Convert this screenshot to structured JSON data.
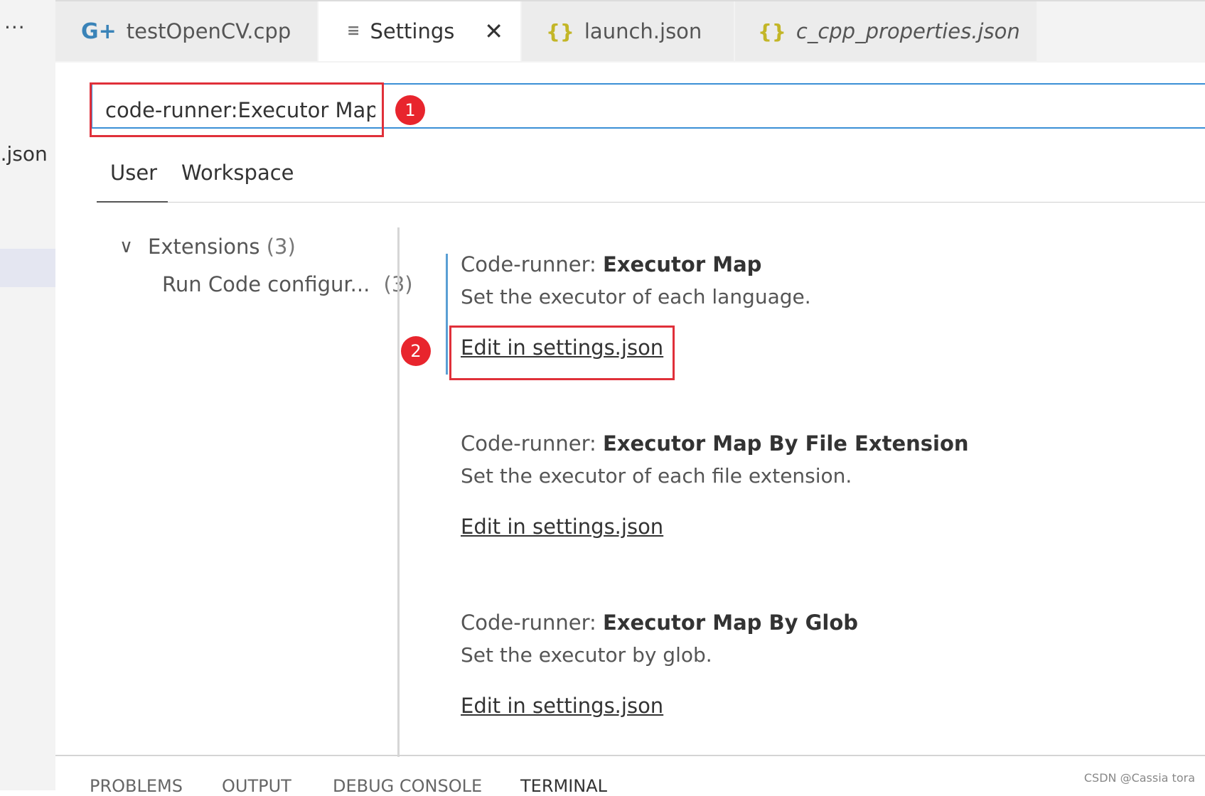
{
  "sidebar": {
    "more_label": "···",
    "file_fragment": "s.json"
  },
  "tabs": [
    {
      "label": "testOpenCV.cpp",
      "icon": "cpp-file-icon",
      "glyph": "G+"
    },
    {
      "label": "Settings",
      "icon": "settings-editor-icon",
      "glyph": "≡",
      "close": "✕"
    },
    {
      "label": "launch.json",
      "icon": "json-file-icon",
      "glyph": "{}"
    },
    {
      "label": "c_cpp_properties.json",
      "icon": "json-file-icon",
      "glyph": "{}"
    }
  ],
  "search": {
    "value": "code-runner:Executor Map"
  },
  "markers": [
    "1",
    "2"
  ],
  "scopes": [
    "User",
    "Workspace"
  ],
  "toc": {
    "chevron": "∨",
    "extensions_label": "Extensions",
    "extensions_count": "(3)",
    "run_code_label": "Run Code configur...",
    "run_code_count": "(3)"
  },
  "settings": [
    {
      "category": "Code-runner: ",
      "name": "Executor Map",
      "description": "Set the executor of each language.",
      "link": "Edit in settings.json"
    },
    {
      "category": "Code-runner: ",
      "name": "Executor Map By File Extension",
      "description": "Set the executor of each file extension.",
      "link": "Edit in settings.json"
    },
    {
      "category": "Code-runner: ",
      "name": "Executor Map By Glob",
      "description": "Set the executor by glob.",
      "link": "Edit in settings.json"
    }
  ],
  "panel_tabs": [
    "PROBLEMS",
    "OUTPUT",
    "DEBUG CONSOLE",
    "TERMINAL"
  ],
  "watermark": "CSDN @Cassia tora",
  "colors": {
    "accent": "#3b8fd6",
    "highlight": "#e0303a",
    "json_icon": "#c3b627",
    "cpp_icon": "#3a83b8"
  }
}
